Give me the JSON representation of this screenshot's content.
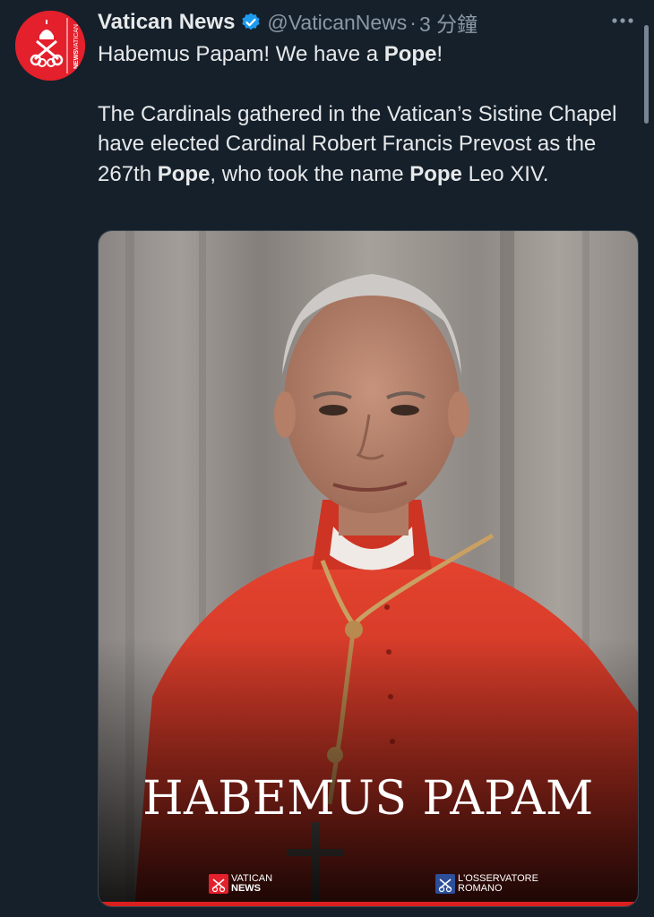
{
  "author": {
    "display_name": "Vatican News",
    "handle": "@VaticanNews",
    "separator": "·",
    "time": "3 分鐘",
    "avatar_text_1": "VATICAN",
    "avatar_text_2": "NEWS"
  },
  "tweet": {
    "line1_a": "Habemus Papam! We have a ",
    "line1_b": "Pope",
    "line1_c": "!",
    "para2_a": "The Cardinals gathered in the Vatican’s Sistine Chapel have elected Cardinal Robert Francis Prevost as the 267th ",
    "para2_b": "Pope",
    "para2_c": ", who took the name ",
    "para2_d": "Pope",
    "para2_e": " Leo XIV."
  },
  "media": {
    "overlay_title": "HABEMUS PAPAM",
    "logo_left_line1": "VATICAN",
    "logo_left_line2": "NEWS",
    "logo_right_line1": "L'OSSERVATORE",
    "logo_right_line2": "ROMANO"
  },
  "colors": {
    "background": "#15202b",
    "text": "#e7e9ea",
    "muted": "#8b98a5",
    "verified": "#1d9bf0",
    "brand_red": "#e3202b"
  },
  "icons": {
    "verified": "verified-badge-icon",
    "more": "more-options-icon",
    "avatar_emblem": "papal-keys-icon"
  }
}
